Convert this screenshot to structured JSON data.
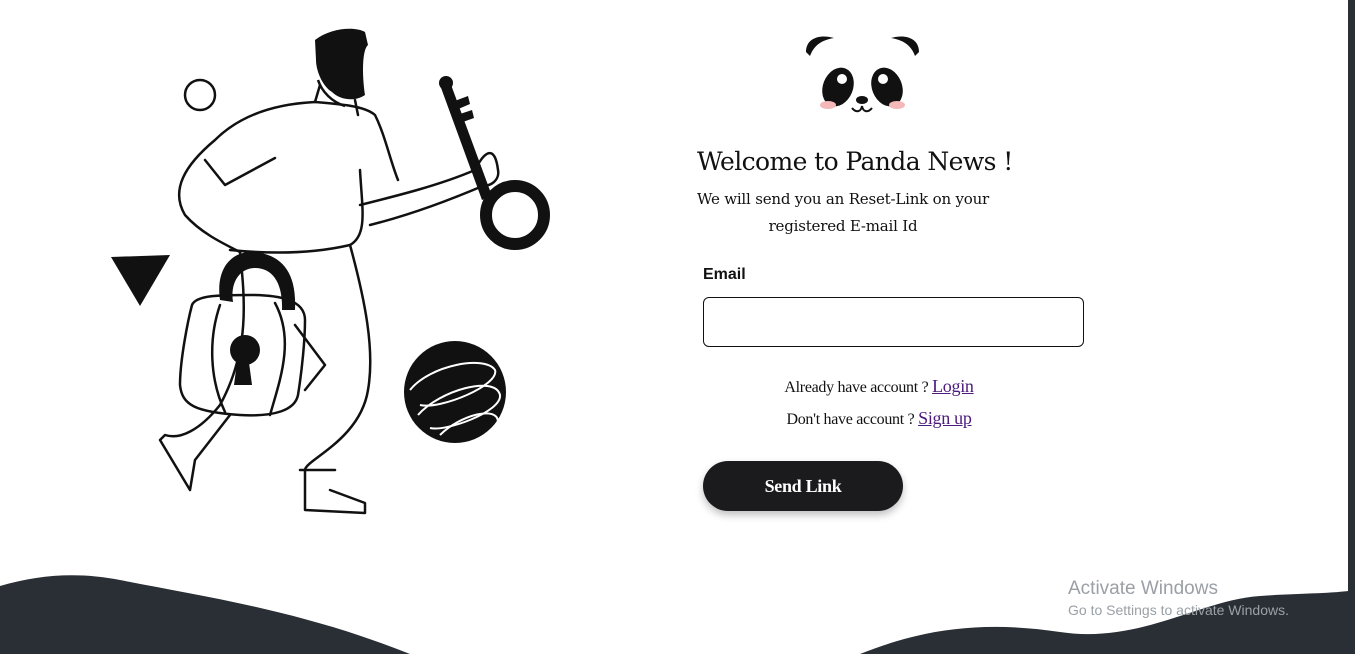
{
  "header": {
    "title": "Welcome to Panda News !",
    "subtitle_line1": "We will send you an Reset-Link on your",
    "subtitle_line2": "registered E-mail Id"
  },
  "form": {
    "email_label": "Email",
    "email_value": "",
    "email_placeholder": "",
    "login_prompt": "Already have account ?",
    "login_link": "Login",
    "signup_prompt": "Don't have account ?",
    "signup_link": "Sign up",
    "submit_label": "Send Link"
  },
  "watermark": {
    "title": "Activate Windows",
    "subtitle": "Go to Settings to activate Windows."
  },
  "colors": {
    "button_bg": "#1b1b1d",
    "link": "#4b1a7c",
    "wave": "#2a2f36",
    "panda_blush": "#f5b8b8"
  }
}
